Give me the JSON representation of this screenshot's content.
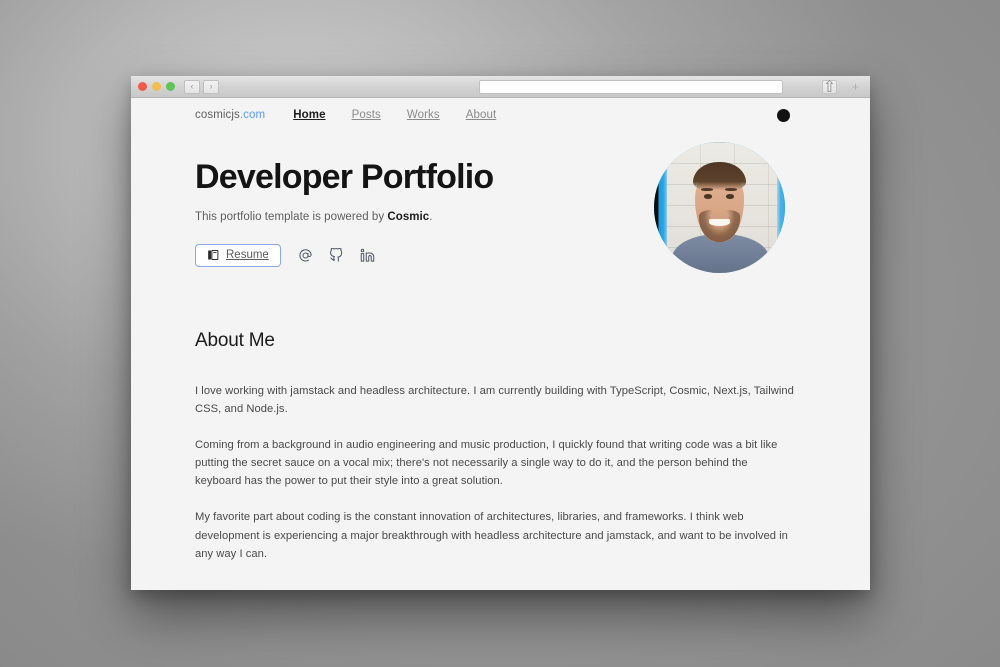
{
  "browser": {
    "address_value": "",
    "address_placeholder": "",
    "traffic_lights": [
      "close",
      "minimize",
      "zoom"
    ],
    "back_glyph": "‹",
    "forward_glyph": "›",
    "share_glyph": "⇧",
    "new_tab_glyph": "+"
  },
  "site_nav": {
    "brand_name": "cosmicjs",
    "brand_tld": ".com",
    "links": [
      {
        "label": "Home",
        "active": true
      },
      {
        "label": "Posts",
        "active": false
      },
      {
        "label": "Works",
        "active": false
      },
      {
        "label": "About",
        "active": false
      }
    ],
    "theme_toggle_name": "dark-mode-toggle"
  },
  "hero": {
    "title": "Developer Portfolio",
    "subtitle_prefix": "This portfolio template is powered by ",
    "subtitle_brand": "Cosmic",
    "subtitle_suffix": ".",
    "resume_label": "Resume",
    "social": [
      {
        "name": "email-icon",
        "glyph": "@"
      },
      {
        "name": "github-icon",
        "glyph": "github"
      },
      {
        "name": "linkedin-icon",
        "glyph": "in"
      }
    ]
  },
  "about": {
    "heading": "About Me",
    "paragraphs": [
      "I love working with jamstack and headless architecture. I am currently building with TypeScript, Cosmic, Next.js, Tailwind CSS, and Node.js.",
      "Coming from a background in audio engineering and music production, I quickly found that writing code was a bit like putting the secret sauce on a vocal mix; there's not necessarily a single way to do it, and the person behind the keyboard has the power to put their style into a great solution.",
      "My favorite part about coding is the constant innovation of architectures, libraries, and frameworks. I think web development is experiencing a major breakthrough with headless architecture and jamstack, and want to be involved in any way I can."
    ]
  },
  "colors": {
    "page_bg": "#f4f4f4",
    "link_blue": "#5b9bf0",
    "resume_border": "#8aa9f2",
    "heading": "#141414",
    "body_text": "#4a4a4a",
    "social_icon": "#4b5563"
  }
}
